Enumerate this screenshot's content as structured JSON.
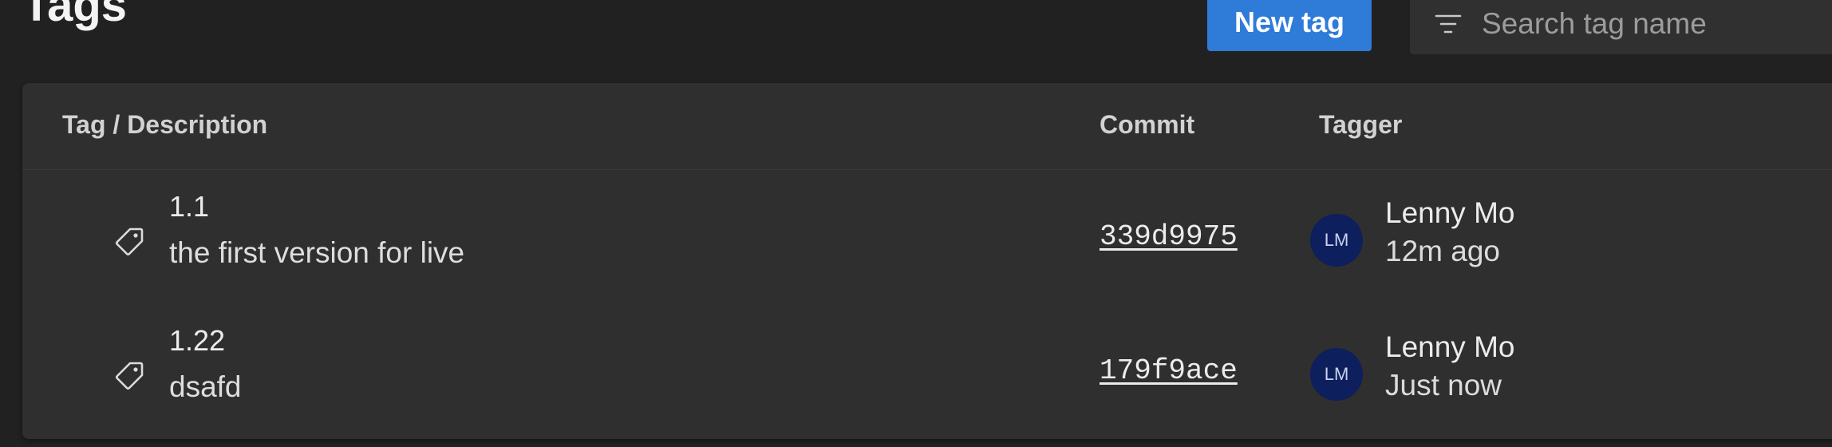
{
  "page": {
    "title": "Tags"
  },
  "toolbar": {
    "new_tag_label": "New tag",
    "search_placeholder": "Search tag name",
    "search_value": ""
  },
  "table": {
    "columns": [
      "Tag / Description",
      "Commit",
      "Tagger"
    ],
    "rows": [
      {
        "tag": "1.1",
        "description": "the first version for live",
        "commit": "339d9975",
        "avatar_initials": "LM",
        "tagger": "Lenny Mo",
        "time": "12m ago"
      },
      {
        "tag": "1.22",
        "description": "dsafd",
        "commit": "179f9ace",
        "avatar_initials": "LM",
        "tagger": "Lenny Mo",
        "time": "Just now"
      }
    ]
  },
  "colors": {
    "background": "#222121",
    "card": "#2f2f2f",
    "primary_button": "#2f7bd8",
    "avatar": "#0d1f5c"
  },
  "icons": [
    "filter-icon",
    "tag-icon"
  ]
}
